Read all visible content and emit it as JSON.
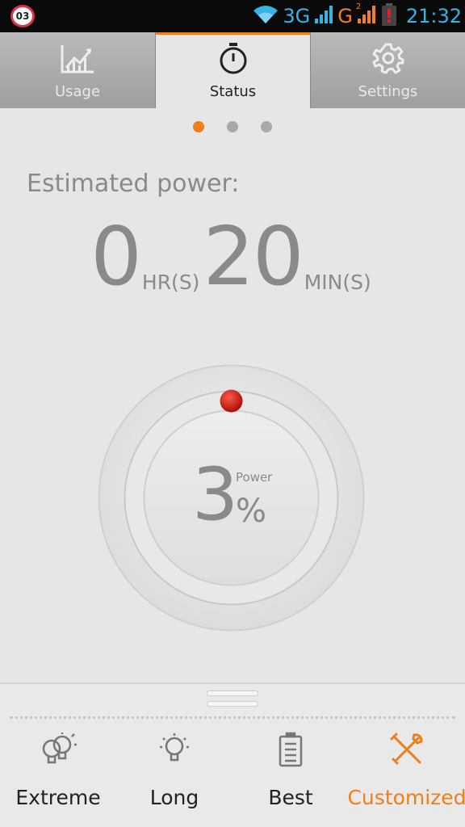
{
  "statusbar": {
    "notification_badge": "03",
    "network_1": "3G",
    "network_2": "G",
    "sim_2_index": "2",
    "time": "21:32",
    "accent_blue": "#33b5e5",
    "accent_orange": "#f08020"
  },
  "tabs": [
    {
      "label": "Usage",
      "icon": "chart-icon",
      "active": false
    },
    {
      "label": "Status",
      "icon": "stopwatch-icon",
      "active": true
    },
    {
      "label": "Settings",
      "icon": "gear-icon",
      "active": false
    }
  ],
  "pager": {
    "count": 3,
    "active_index": 0
  },
  "estimate": {
    "label": "Estimated power:",
    "hours": "0",
    "hours_unit": "HR(S)",
    "minutes": "20",
    "minutes_unit": "MIN(S)"
  },
  "battery": {
    "percent_value": "3",
    "percent_sign": "%",
    "label": "Power",
    "level_fraction": 0.03,
    "indicator_color": "#cc1c14"
  },
  "modes": [
    {
      "label": "Extreme",
      "icon": "double-bulb-icon",
      "active": false
    },
    {
      "label": "Long",
      "icon": "bulb-icon",
      "active": false
    },
    {
      "label": "Best",
      "icon": "battery-icon",
      "active": false
    },
    {
      "label": "Customized",
      "icon": "tools-icon",
      "active": true
    }
  ],
  "colors": {
    "accent": "#ef7f1a",
    "background": "#e6e6e6"
  }
}
